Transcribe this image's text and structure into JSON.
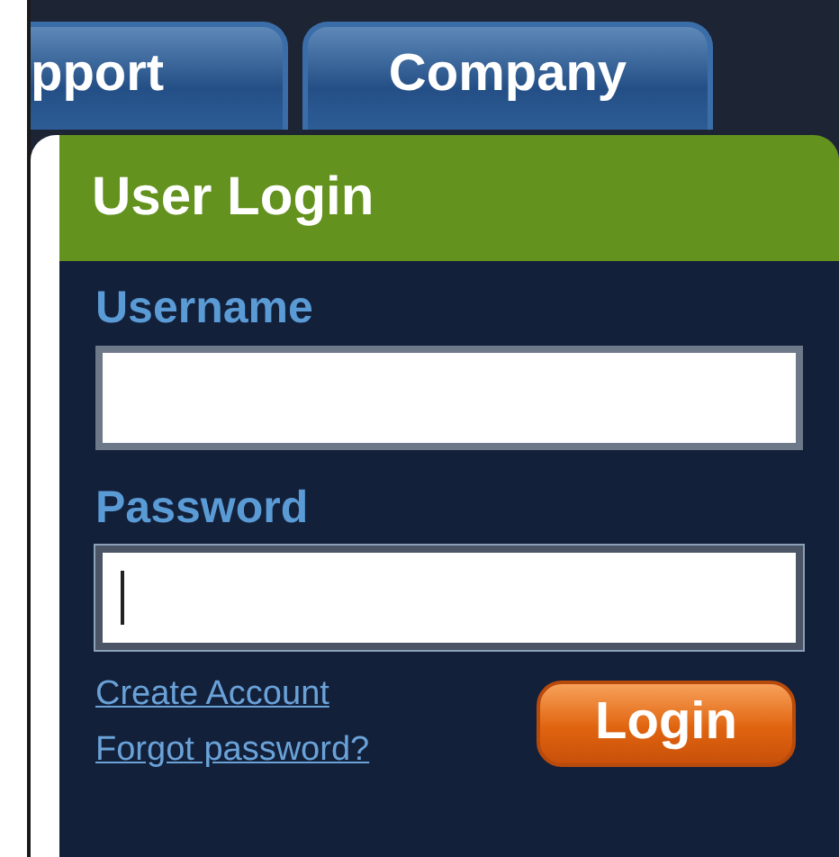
{
  "tabs": [
    {
      "label": "pport",
      "selected": false
    },
    {
      "label": "Company",
      "selected": false
    }
  ],
  "login": {
    "title": "User Login",
    "fields": [
      {
        "label": "Username",
        "focused": false
      },
      {
        "label": "Password",
        "focused": true
      }
    ],
    "links": [
      "Create Account",
      "Forgot password?"
    ],
    "button": "Login"
  }
}
